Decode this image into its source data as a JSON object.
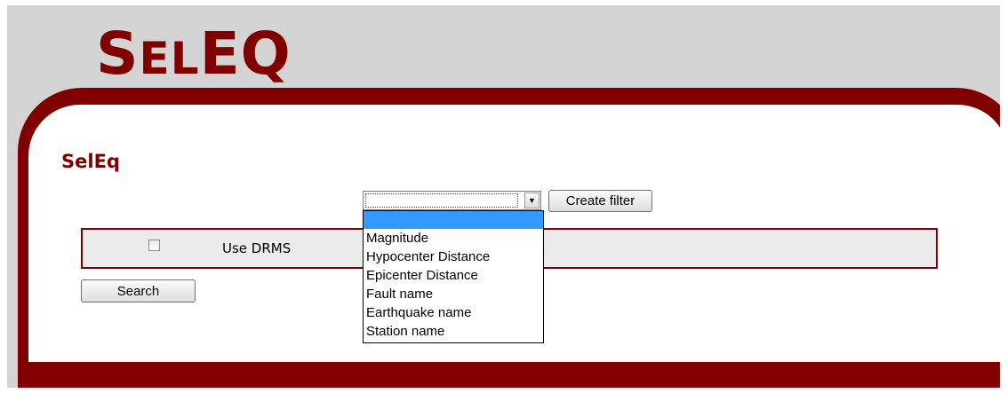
{
  "header": {
    "logo_big": "S",
    "logo_small": "EL",
    "logo_tail": "EQ"
  },
  "page": {
    "title": "SelEq"
  },
  "filter": {
    "selected": "",
    "create_label": "Create filter",
    "options": [
      "",
      "Magnitude",
      "Hypocenter Distance",
      "Epicenter Distance",
      "Fault name",
      "Earthquake name",
      "Station name"
    ]
  },
  "drms": {
    "label": "Use DRMS",
    "checked": false
  },
  "search": {
    "label": "Search"
  },
  "colors": {
    "brand": "#800000",
    "highlight": "#3399ff",
    "background": "#d4d4d4"
  },
  "icons": {
    "dropdown_arrow": "chevron-down-icon"
  }
}
